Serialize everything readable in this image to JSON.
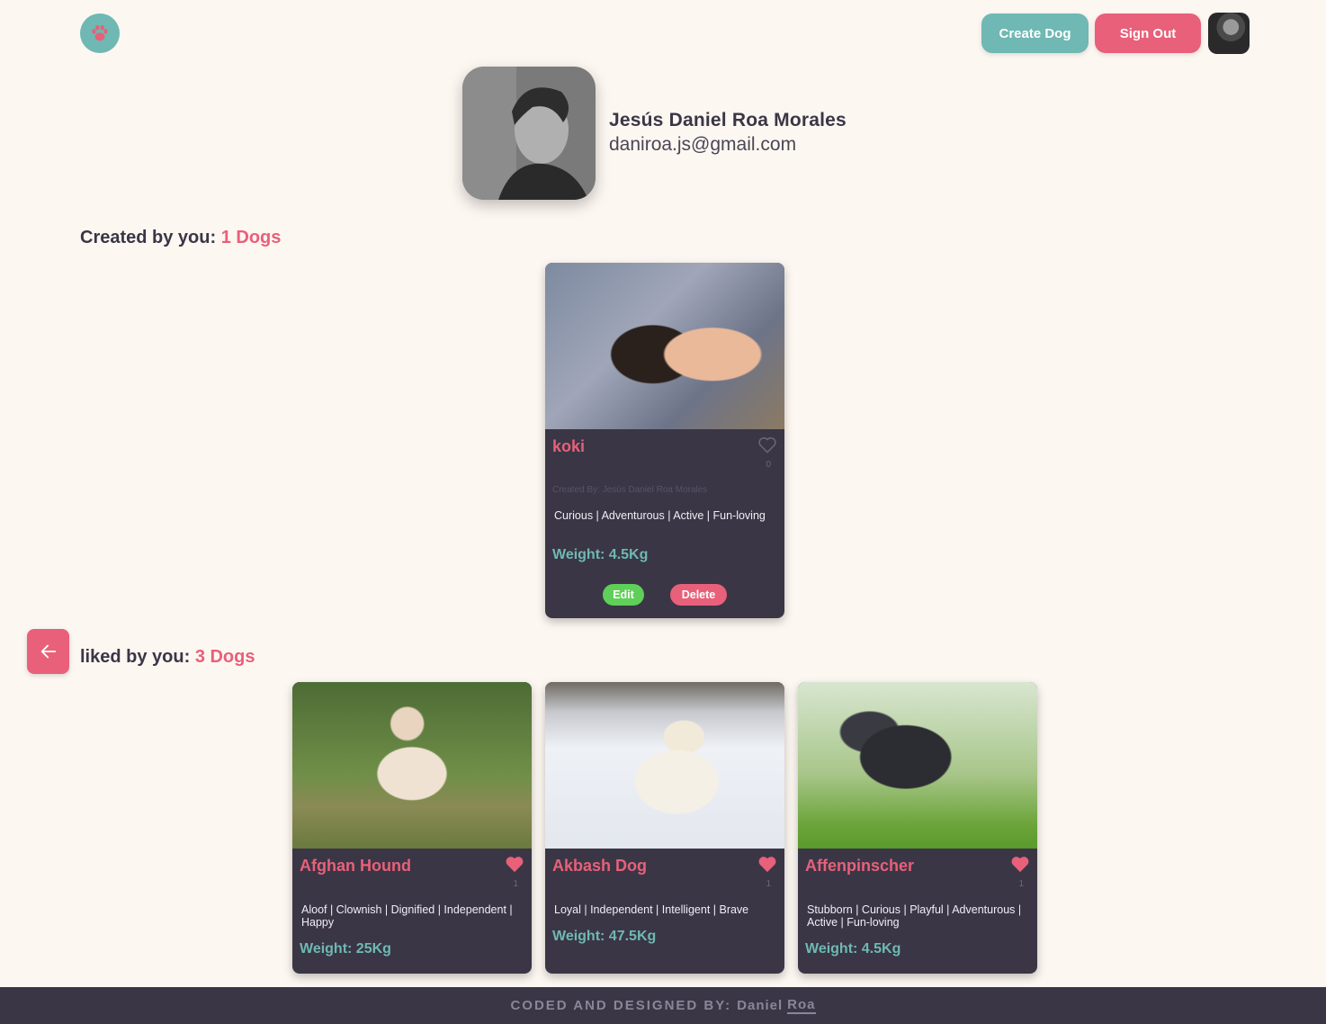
{
  "header": {
    "logo_icon": "paw-icon",
    "create_label": "Create Dog",
    "signout_label": "Sign Out",
    "colors": {
      "teal": "#6fb8b3",
      "pink": "#e8607a",
      "dark": "#3a3645",
      "background": "#fdf7f2"
    }
  },
  "profile": {
    "name": "Jesús Daniel Roa Morales",
    "email": "daniroa.js@gmail.com"
  },
  "created": {
    "label": "Created by you:",
    "count": "1 Dogs",
    "dogs": [
      {
        "name": "koki",
        "likes": "0",
        "creator": "Created By: Jesús Daniel Roa Morales",
        "temperament": "Curious | Adventurous | Active | Fun-loving",
        "weight": "Weight: 4.5Kg",
        "edit_label": "Edit",
        "delete_label": "Delete",
        "liked": false
      }
    ]
  },
  "liked": {
    "label": "liked by you:",
    "count": "3 Dogs",
    "back_icon": "arrow-left-icon",
    "dogs": [
      {
        "name": "Afghan Hound",
        "likes": "1",
        "temperament": "Aloof | Clownish | Dignified | Independent | Happy",
        "weight": "Weight: 25Kg",
        "liked": true
      },
      {
        "name": "Akbash Dog",
        "likes": "1",
        "temperament": "Loyal | Independent | Intelligent | Brave",
        "weight": "Weight: 47.5Kg",
        "liked": true
      },
      {
        "name": "Affenpinscher",
        "likes": "1",
        "temperament": "Stubborn | Curious | Playful | Adventurous | Active | Fun-loving",
        "weight": "Weight: 4.5Kg",
        "liked": true
      }
    ]
  },
  "footer": {
    "text": "CODED AND DESIGNED BY:",
    "author_first": "Daniel",
    "author_link": "Roa"
  }
}
